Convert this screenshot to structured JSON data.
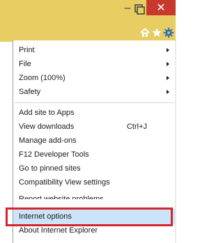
{
  "window": {
    "minimize_label": "–",
    "close_label": "✕",
    "accent_color": "#e8cd63",
    "close_color": "#c7392d"
  },
  "toolbar": {
    "icons": [
      "home-icon",
      "favorites-star-icon",
      "tools-gear-icon"
    ]
  },
  "menu": {
    "items": [
      {
        "label": "Print",
        "submenu": true
      },
      {
        "label": "File",
        "submenu": true
      },
      {
        "label": "Zoom (100%)",
        "submenu": true
      },
      {
        "label": "Safety",
        "submenu": true
      },
      {
        "label": "Add site to Apps"
      },
      {
        "label": "View downloads",
        "shortcut": "Ctrl+J"
      },
      {
        "label": "Manage add-ons"
      },
      {
        "label": "F12 Developer Tools"
      },
      {
        "label": "Go to pinned sites"
      },
      {
        "label": "Compatibility View settings"
      },
      {
        "label": "Report website problems"
      },
      {
        "label": "Internet options"
      },
      {
        "label": "About Internet Explorer"
      }
    ]
  },
  "highlight_color": "#d4242e"
}
